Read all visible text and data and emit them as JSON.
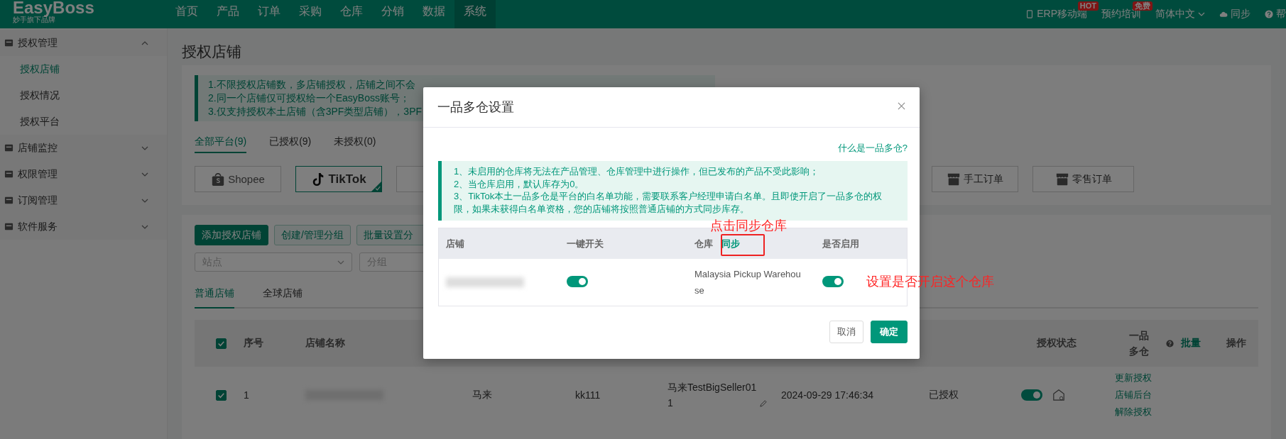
{
  "topbar": {
    "logo": "EasyBoss",
    "logo_sub": "妙手旗下品牌",
    "nav": [
      {
        "label": "首页",
        "selected": false
      },
      {
        "label": "产品",
        "selected": false
      },
      {
        "label": "订单",
        "selected": false
      },
      {
        "label": "采购",
        "selected": false
      },
      {
        "label": "仓库",
        "selected": false
      },
      {
        "label": "分销",
        "selected": false
      },
      {
        "label": "数据",
        "selected": false
      },
      {
        "label": "系统",
        "selected": true
      }
    ],
    "right": [
      {
        "kind": "mobile",
        "label": "ERP移动端",
        "badge": "HOT"
      },
      {
        "kind": "plain",
        "label": "预约培训",
        "badge": "免费"
      },
      {
        "kind": "lang",
        "label": "简体中文"
      },
      {
        "kind": "sync",
        "label": "同步"
      },
      {
        "kind": "help",
        "label": "帮"
      }
    ]
  },
  "sidebar": {
    "items": [
      {
        "label": "授权管理",
        "expanded": true,
        "children": [
          {
            "label": "授权店铺",
            "selected": true
          },
          {
            "label": "授权情况",
            "selected": false
          },
          {
            "label": "授权平台",
            "selected": false
          }
        ]
      },
      {
        "label": "店铺监控",
        "expanded": false
      },
      {
        "label": "权限管理",
        "expanded": false
      },
      {
        "label": "订阅管理",
        "expanded": false
      },
      {
        "label": "软件服务",
        "expanded": false
      }
    ]
  },
  "page_title": "授权店铺",
  "notice": [
    "1.不限授权店铺数，多店铺授权，店铺之间不会",
    "2.同一个店铺仅可授权给一个EasyBoss账号；",
    "3.仅支持授权本土店铺（含3PF类型店铺），3PF"
  ],
  "filter_tabs": [
    {
      "label": "全部平台(9)",
      "selected": true
    },
    {
      "label": "已授权(9)",
      "selected": false
    },
    {
      "label": "未授权(0)",
      "selected": false
    }
  ],
  "platforms": [
    {
      "kind": "shopee",
      "label": "Shopee",
      "selected": false
    },
    {
      "kind": "tiktok",
      "label": "TikTok",
      "selected": true
    },
    {
      "kind": "box",
      "selected": false
    },
    {
      "kind": "manual",
      "label": "手工订单",
      "selected": false
    },
    {
      "kind": "retail",
      "label": "零售订单",
      "selected": false
    }
  ],
  "actions": [
    {
      "label": "添加授权店铺",
      "primary": true
    },
    {
      "label": "创建/管理分组",
      "primary": false
    },
    {
      "label": "批量设置分",
      "primary": false
    }
  ],
  "filters": [
    {
      "placeholder": "站点"
    },
    {
      "placeholder": "分组"
    }
  ],
  "store_tabs": [
    {
      "label": "普通店铺",
      "selected": true
    },
    {
      "label": "全球店铺",
      "selected": false
    }
  ],
  "table": {
    "select_all": true,
    "header": {
      "index": "序号",
      "store_name": "店铺名称",
      "auth_status": "授权状态",
      "multi_warehouse": "一品多仓",
      "batch": "批量",
      "actions": "操作"
    },
    "rows": [
      {
        "checked": true,
        "index": "1",
        "site": "马来",
        "column_5": "kk111",
        "column_6": "马来TestBigSeller011",
        "authorized_at": "2024-09-29 17:46:34",
        "auth_status": "已授权",
        "multi_warehouse_on": true,
        "actions": [
          "更新授权",
          "店铺后台",
          "解除授权"
        ]
      }
    ]
  },
  "modal": {
    "title": "一品多仓设置",
    "help_link": "什么是一品多仓?",
    "notes": [
      "1、未启用的仓库将无法在产品管理、仓库管理中进行操作，但已发布的产品不受此影响；",
      "2、当仓库启用，默认库存为0。",
      "3、TikTok本土一品多仓是平台的白名单功能，需要联系客户经理申请白名单。且即使开启了一品多仓的权限，如果未获得白名单资格，您的店铺将按照普通店铺的方式同步库存。"
    ],
    "columns": {
      "store": "店铺",
      "master_switch": "一键开关",
      "warehouse": "仓库",
      "sync": "同步",
      "enabled": "是否启用"
    },
    "rows": [
      {
        "master_on": true,
        "warehouse": "Malaysia Pickup Warehouse",
        "enabled": true
      }
    ],
    "cancel": "取消",
    "confirm": "确定"
  },
  "annotations": [
    {
      "kind": "sync",
      "text": "点击同步仓库"
    },
    {
      "kind": "enable",
      "text": "设置是否开启这个仓库"
    }
  ]
}
